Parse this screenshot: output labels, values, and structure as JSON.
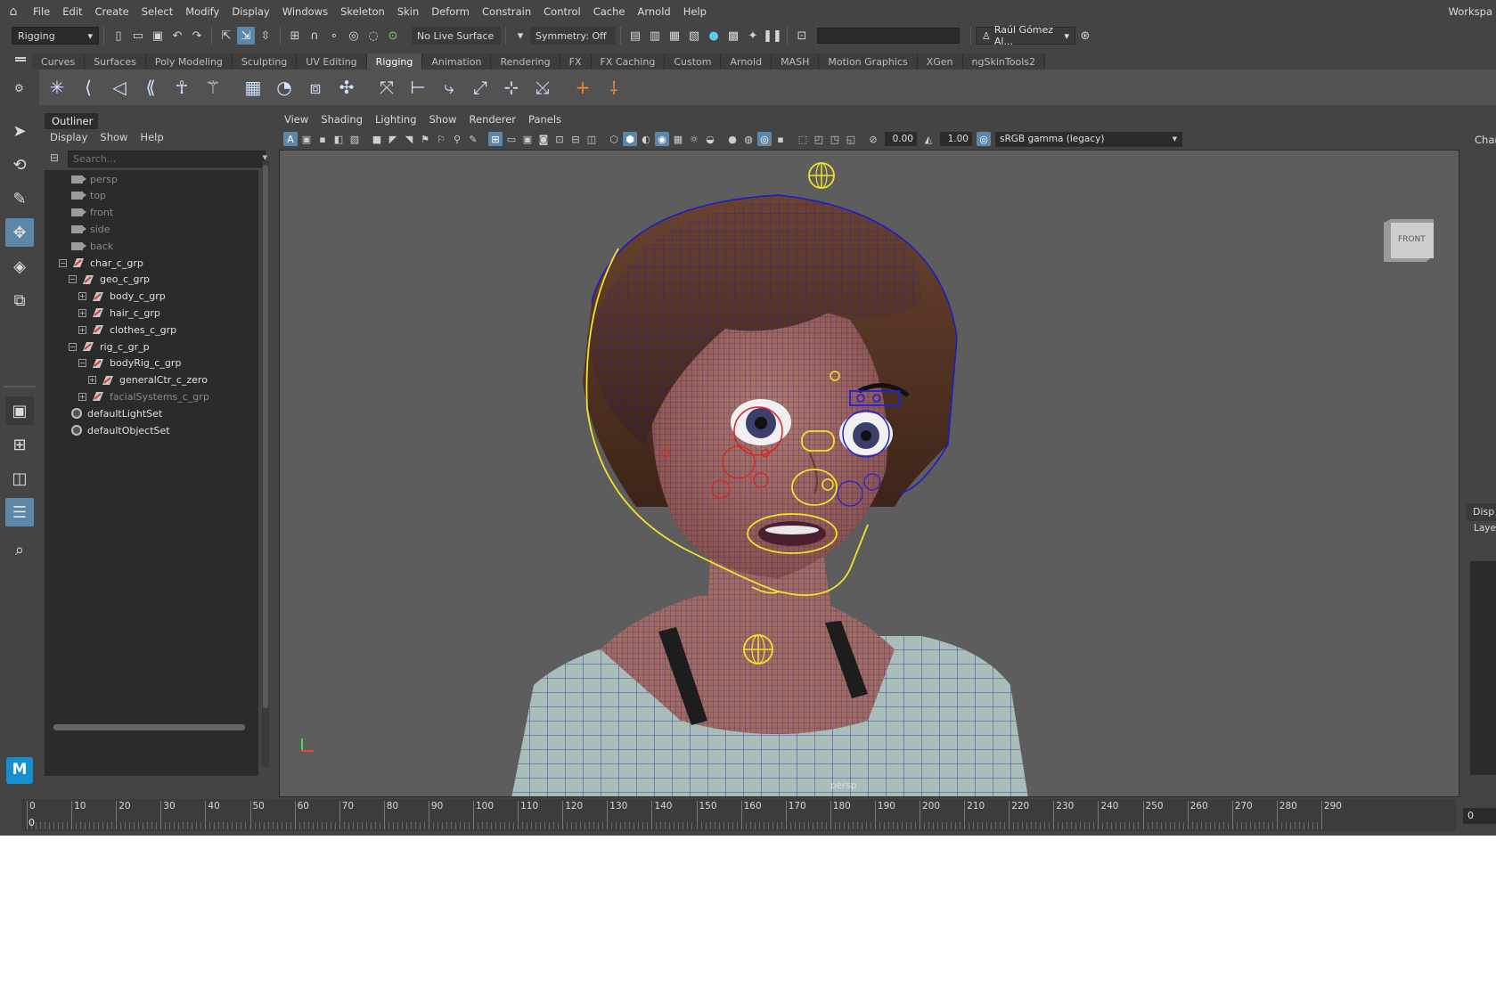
{
  "menubar": {
    "items": [
      "File",
      "Edit",
      "Create",
      "Select",
      "Modify",
      "Display",
      "Windows",
      "Skeleton",
      "Skin",
      "Deform",
      "Constrain",
      "Control",
      "Cache",
      "Arnold",
      "Help"
    ],
    "workspace": "Workspa"
  },
  "statusline": {
    "menuset": "Rigging",
    "live_surface": "No Live Surface",
    "symmetry": "Symmetry: Off",
    "user": "Raúl Gómez Al..."
  },
  "shelf": {
    "tabs": [
      "Curves",
      "Surfaces",
      "Poly Modeling",
      "Sculpting",
      "UV Editing",
      "Rigging",
      "Animation",
      "Rendering",
      "FX",
      "FX Caching",
      "Custom",
      "Arnold",
      "MASH",
      "Motion Graphics",
      "XGen",
      "ngSkinTools2"
    ],
    "active_tab": "Rigging",
    "icons": [
      "joint-tool-icon",
      "ik-handle-icon",
      "ik-spline-icon",
      "insert-joint-icon",
      "human-ik-icon",
      "quick-rig-icon",
      "bind-skin-icon",
      "paint-weights-icon",
      "lattice-icon",
      "cluster-icon",
      "parent-constraint-icon",
      "point-constraint-icon",
      "orient-constraint-icon",
      "scale-constraint-icon",
      "aim-constraint-icon",
      "pole-vector-icon",
      "locator-icon",
      "freeze-transform-icon"
    ]
  },
  "toolbox": {
    "tools": [
      "select-tool-icon",
      "lasso-tool-icon",
      "paint-select-icon",
      "move-tool-icon",
      "rotate-tool-icon",
      "scale-tool-icon"
    ],
    "active": "move-tool-icon"
  },
  "outliner": {
    "title": "Outliner",
    "menus": [
      "Display",
      "Show",
      "Help"
    ],
    "search_placeholder": "Search...",
    "items": [
      {
        "label": "persp",
        "kind": "camera",
        "depth": 0
      },
      {
        "label": "top",
        "kind": "camera",
        "depth": 0
      },
      {
        "label": "front",
        "kind": "camera",
        "depth": 0
      },
      {
        "label": "side",
        "kind": "camera",
        "depth": 0
      },
      {
        "label": "back",
        "kind": "camera",
        "depth": 0
      },
      {
        "label": "char_c_grp",
        "kind": "group",
        "depth": 0,
        "expander": "−"
      },
      {
        "label": "geo_c_grp",
        "kind": "group",
        "depth": 1,
        "expander": "−"
      },
      {
        "label": "body_c_grp",
        "kind": "group",
        "depth": 2,
        "expander": "+"
      },
      {
        "label": "hair_c_grp",
        "kind": "group",
        "depth": 2,
        "expander": "+"
      },
      {
        "label": "clothes_c_grp",
        "kind": "group",
        "depth": 2,
        "expander": "+"
      },
      {
        "label": "rig_c_gr_p",
        "kind": "group",
        "depth": 1,
        "expander": "−"
      },
      {
        "label": "bodyRig_c_grp",
        "kind": "group",
        "depth": 2,
        "expander": "−"
      },
      {
        "label": "generalCtr_c_zero",
        "kind": "group",
        "depth": 3,
        "expander": "+"
      },
      {
        "label": "facialSystems_c_grp",
        "kind": "group",
        "depth": 2,
        "expander": "+",
        "dim": true
      },
      {
        "label": "defaultLightSet",
        "kind": "set",
        "depth": 0
      },
      {
        "label": "defaultObjectSet",
        "kind": "set",
        "depth": 0
      }
    ]
  },
  "viewport": {
    "menus": [
      "View",
      "Shading",
      "Lighting",
      "Show",
      "Renderer",
      "Panels"
    ],
    "exposure": "0.00",
    "gamma": "1.00",
    "color_space": "sRGB gamma (legacy)",
    "camera_label": "persp",
    "viewcube_label": "FRONT"
  },
  "right_panel": {
    "channel_box": "Chan",
    "display_tab": "Disp",
    "layers": "Laye"
  },
  "timeslider": {
    "ticks": [
      0,
      10,
      20,
      30,
      40,
      50,
      60,
      70,
      80,
      90,
      100,
      110,
      120,
      130,
      140,
      150,
      160,
      170,
      180,
      190,
      200,
      210,
      220,
      230,
      240,
      250,
      260,
      270,
      280,
      290
    ],
    "current_frame": "0",
    "frame_field": "0"
  },
  "colors": {
    "ui_bg": "#444444",
    "panel_dark": "#2b2b2b",
    "active_blue": "#5d87a8",
    "viewport_bg": "#5d5d5d",
    "wire_blue": "#1a1ad0",
    "control_yellow": "#f2e22a",
    "control_red": "#e02020"
  }
}
